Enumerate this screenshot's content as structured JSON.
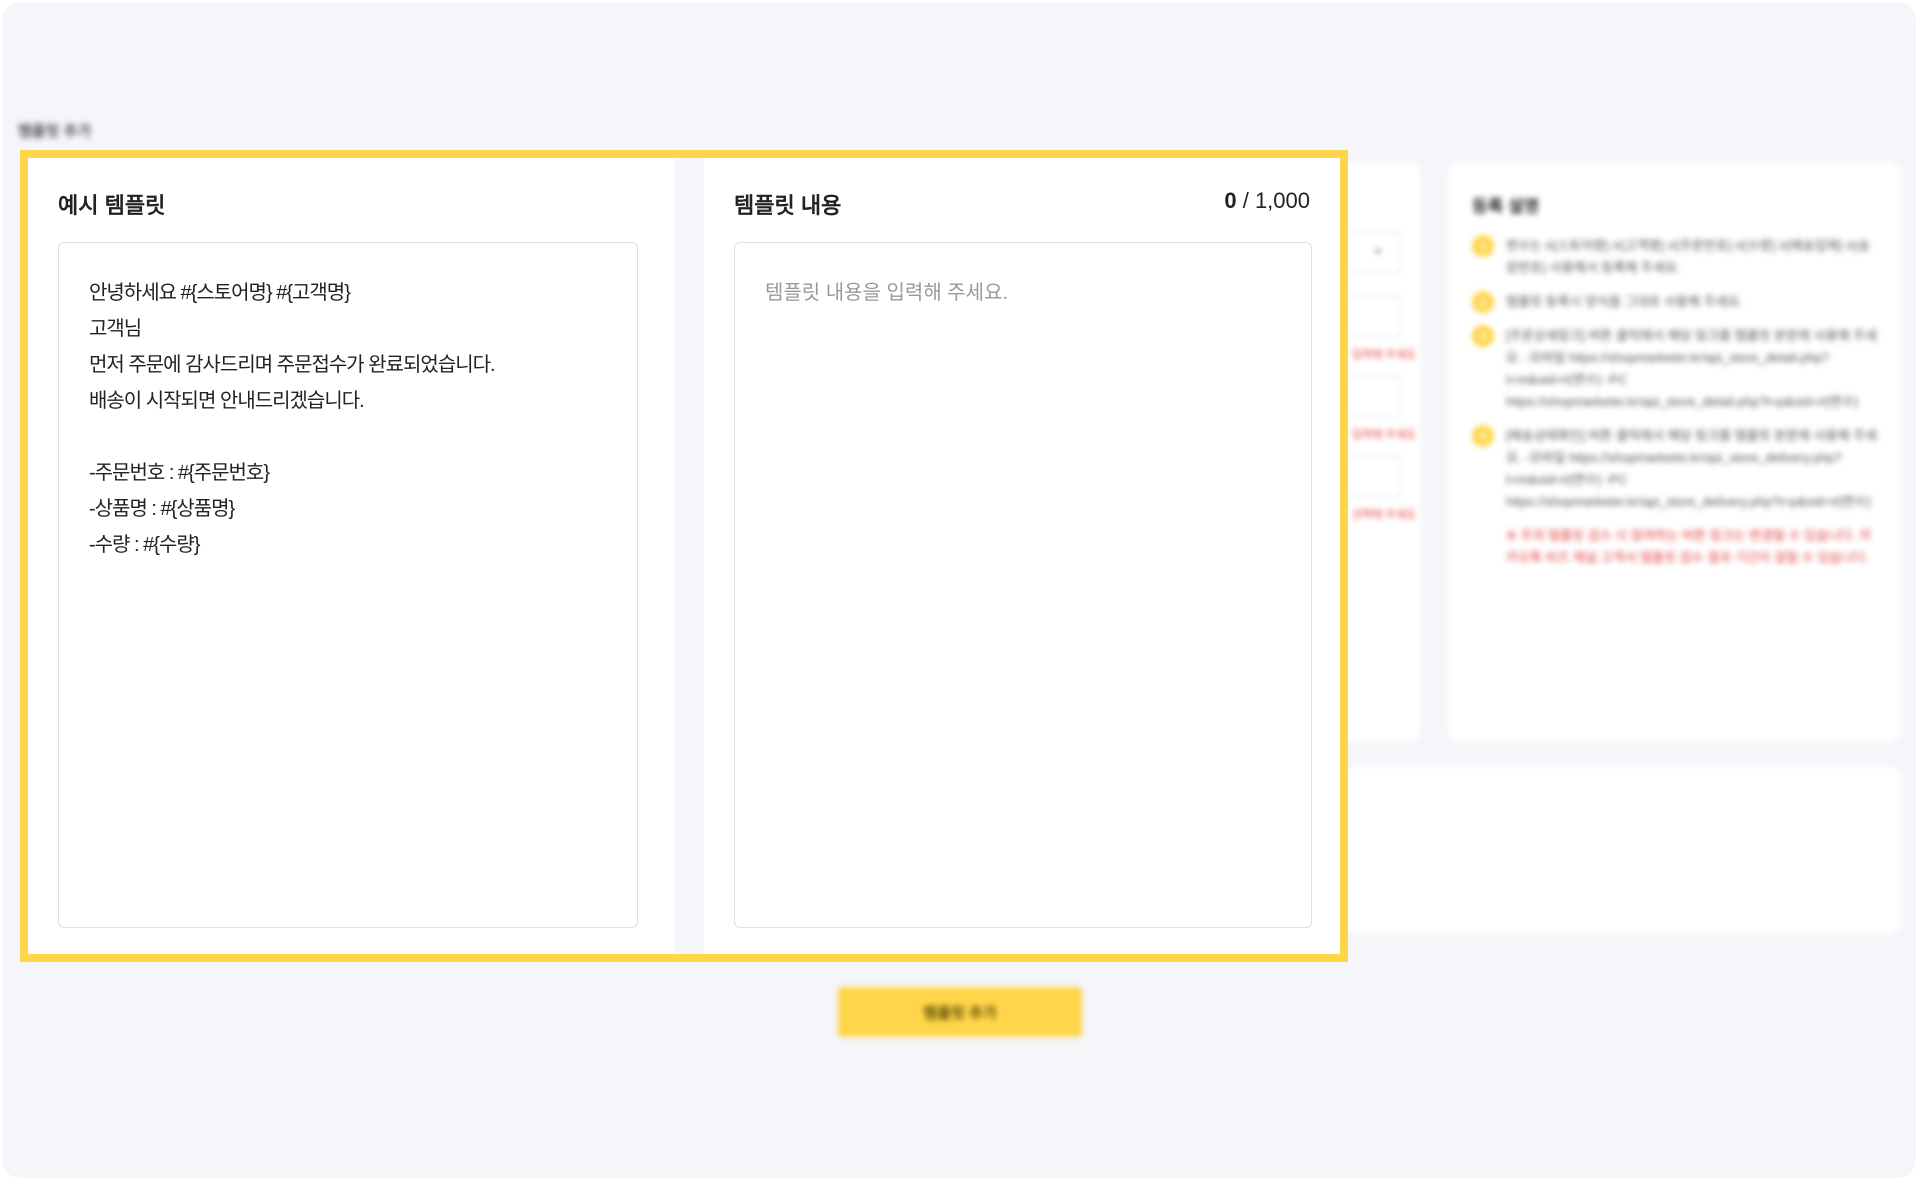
{
  "section_label": "템플릿 추가",
  "sample_panel": {
    "title": "예시 템플릿",
    "lines": [
      "안녕하세요 #{스토어명} #{고객명}",
      "고객님",
      "먼저 주문에 감사드리며 주문접수가 완료되었습니다.",
      "배송이 시작되면 안내드리겠습니다.",
      "",
      "-주문번호 : #{주문번호}",
      "-상품명 : #{상품명}",
      "-수량 : #{수량}"
    ]
  },
  "content_panel": {
    "title": "템플릿 내용",
    "char_count": "0",
    "char_limit": "/ 1,000",
    "input_value": "",
    "placeholder": "템플릿 내용을 입력해 주세요."
  },
  "info_card": {
    "title": "등록 설명",
    "items": [
      {
        "num": "1",
        "text": "변수는 #{스토어명} #{고객명} #{주문번호} #{수량} #{배송업체} #{송장번호} 사용해서 등록해 주세요."
      },
      {
        "num": "2",
        "text": "템플릿 등록시 양식을 그대로 사용해 주세요."
      },
      {
        "num": "3",
        "text": "[주문상세링크] 버튼 클릭에서 해당 링크를 템플릿 본문에 사용해 주세요. -모바일 https://shopmarketer.kr/api_store_detail.php?t=m&oid=#{변수} -PC https://shopmarketer.kr/api_store_detail.php?t=p&oid=#{변수}"
      },
      {
        "num": "4",
        "text": "[배송상태확인] 버튼 클릭에서 해당 링크를 템플릿 본문에 사용해 주세요. -모바일 https://shopmarketer.kr/api_store_delivery.php?t=m&oid=#{변수} -PC https://shopmarketer.kr/api_store_delivery.php?t=p&oid=#{변수}"
      }
    ],
    "warning": "※ 주의 템플릿 검수 시 참여하는 버튼 링크는 변경될 수 있습니다. 카카오톡 비즈 채널 고객서 템플릿 검수 결과 기간이 걸릴 수 있습니다."
  },
  "right_form": {
    "errors": [
      "입력해 주세요",
      "입력해 주세요",
      "선택해 주세요"
    ]
  },
  "add_button": {
    "label": "템플릿 추가"
  },
  "colors": {
    "accent": "#ffd54a",
    "background": "#f5f6fa",
    "warning": "#e23b3b"
  }
}
